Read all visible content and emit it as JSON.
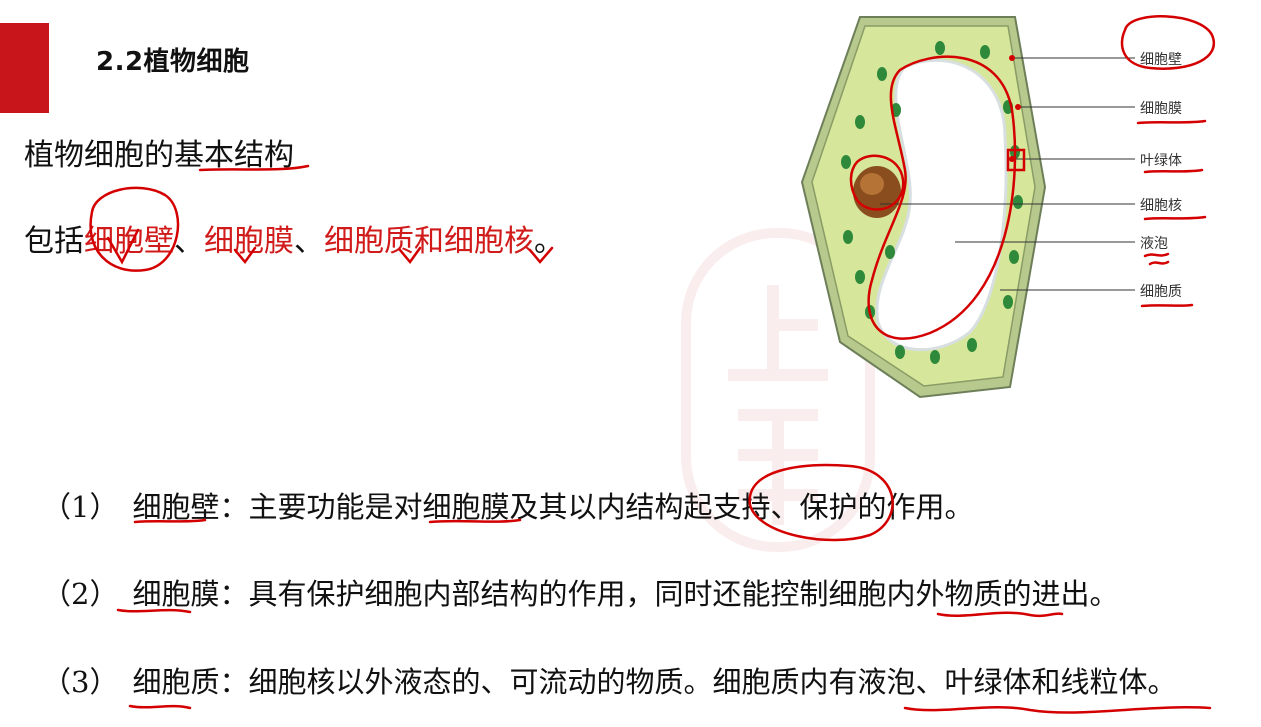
{
  "header": {
    "title": "2.2植物细胞"
  },
  "subtitle": "植物细胞的基本结构",
  "includes": {
    "prefix": "包括",
    "parts": [
      "细胞壁",
      "细胞膜",
      "细胞质",
      "细胞核"
    ],
    "sep1": "、",
    "sep2": "、",
    "sep3": "和",
    "suffix": "。"
  },
  "diagram": {
    "labels": {
      "cell_wall": "细胞壁",
      "cell_membrane": "细胞膜",
      "chloroplast": "叶绿体",
      "nucleus": "细胞核",
      "vacuole": "液泡",
      "cytoplasm": "细胞质"
    }
  },
  "points": [
    {
      "num": "（1）",
      "term": "细胞壁",
      "text": "：主要功能是对细胞膜及其以内结构起支持、保护的作用。"
    },
    {
      "num": "（2）",
      "term": "细胞膜",
      "text": "：具有保护细胞内部结构的作用，同时还能控制细胞内外物质的进出。"
    },
    {
      "num": "（3）",
      "term": "细胞质",
      "text": "：细胞核以外液态的、可流动的物质。细胞质内有液泡、叶绿体和线粒体。"
    }
  ],
  "colors": {
    "accent": "#c8141b",
    "annotation": "#d40000",
    "cell_green": "#c9dc7a"
  }
}
